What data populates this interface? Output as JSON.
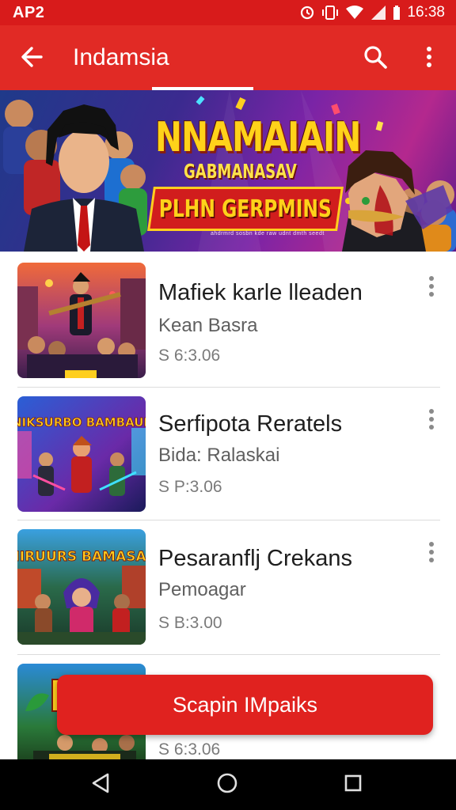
{
  "status_bar": {
    "left_text": "AP2",
    "time": "16:38",
    "icons": [
      "alarm-icon",
      "vibrate-icon",
      "wifi-icon",
      "signal-icon",
      "battery-icon"
    ]
  },
  "app_bar": {
    "title": "Indamsia",
    "icons": [
      "back-arrow-icon",
      "search-icon",
      "more-vert-icon"
    ]
  },
  "banner": {
    "headline": "NNAMAIAIN",
    "subheadline": "GABMANASAV",
    "cta": "PLHN GERPMINS",
    "fine_print": "ahdrmrd sosbn kde raw udnt dmth seedt"
  },
  "list": {
    "items": [
      {
        "title": "Mafiek karle lleaden",
        "subtitle": "Kean Basra",
        "price": "S 6:3.06"
      },
      {
        "title": "Serfipota Reratels",
        "subtitle": "Bida: Ralaskai",
        "price": "S P:3.06"
      },
      {
        "title": "Pesaranflj Crekans",
        "subtitle": "Pemoagar",
        "price": "S B:3.00"
      },
      {
        "title": "",
        "subtitle": "",
        "price": "S 6:3.06"
      }
    ],
    "thumb_badges": [
      "NIKSURBO BAMBAUL",
      "NIRUURS BAMASAL",
      ""
    ]
  },
  "floating_action": {
    "label": "Scapin IMpaiks"
  },
  "nav_bar": {
    "icons": [
      "back-triangle-icon",
      "home-circle-icon",
      "recents-square-icon"
    ]
  },
  "colors": {
    "brand_red": "#e12a25",
    "status_red": "#d81b1b",
    "banner_yellow": "#ffd21a"
  }
}
